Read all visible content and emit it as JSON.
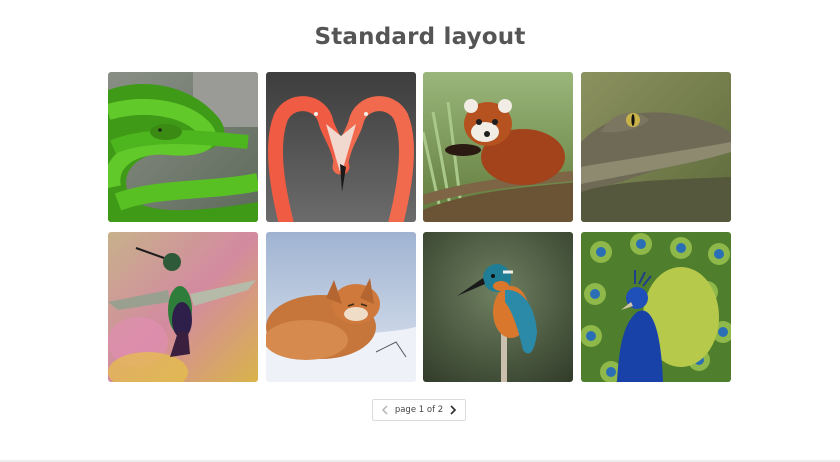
{
  "header": {
    "title": "Standard layout"
  },
  "gallery": {
    "images": [
      {
        "subject": "green snake",
        "icon": "green-snake-photo"
      },
      {
        "subject": "flamingos",
        "icon": "flamingos-photo"
      },
      {
        "subject": "red panda",
        "icon": "red-panda-photo"
      },
      {
        "subject": "crocodile",
        "icon": "crocodile-photo"
      },
      {
        "subject": "hummingbird",
        "icon": "hummingbird-photo"
      },
      {
        "subject": "fox",
        "icon": "fox-photo"
      },
      {
        "subject": "kingfisher",
        "icon": "kingfisher-photo"
      },
      {
        "subject": "peacock",
        "icon": "peacock-photo"
      }
    ]
  },
  "pagination": {
    "label": "page 1 of 2",
    "current_page": 1,
    "total_pages": 2,
    "prev_icon": "chevron-left-icon",
    "next_icon": "chevron-right-icon"
  },
  "colors": {
    "title": "#555555",
    "pager_border": "#dcdcdc",
    "prev_disabled": "#b5b5b5",
    "next_enabled": "#333333"
  }
}
